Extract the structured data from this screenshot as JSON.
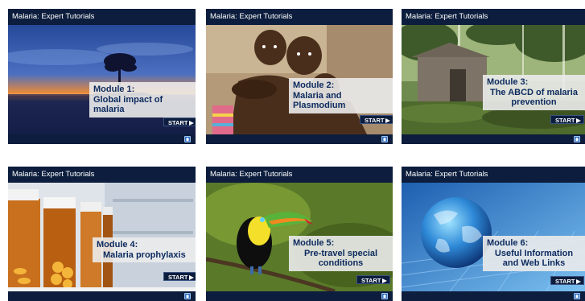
{
  "tiles": [
    {
      "header": "Malaria: Expert Tutorials",
      "module": "Module 1:",
      "title": "Global impact of malaria",
      "start": "START"
    },
    {
      "header": "Malaria: Expert Tutorials",
      "module": "Module 2:",
      "title": "Malaria and Plasmodium",
      "start": "START"
    },
    {
      "header": "Malaria: Expert Tutorials",
      "module": "Module 3:",
      "title": "The ABCD of malaria prevention",
      "start": "START"
    },
    {
      "header": "Malaria: Expert Tutorials",
      "module": "Module 4:",
      "title": "Malaria prophylaxis",
      "start": "START"
    },
    {
      "header": "Malaria: Expert Tutorials",
      "module": "Module 5:",
      "title": "Pre-travel special conditions",
      "start": "START"
    },
    {
      "header": "Malaria: Expert Tutorials",
      "module": "Module 6:",
      "title": "Useful Information and Web Links",
      "start": "START"
    }
  ],
  "icons": {
    "start": "play-triangle-icon",
    "home": "home-icon"
  },
  "colors": {
    "header_bg": "#0c1d3d",
    "label_text": "#0c2a5e",
    "home_button": "#2f6fc0"
  }
}
